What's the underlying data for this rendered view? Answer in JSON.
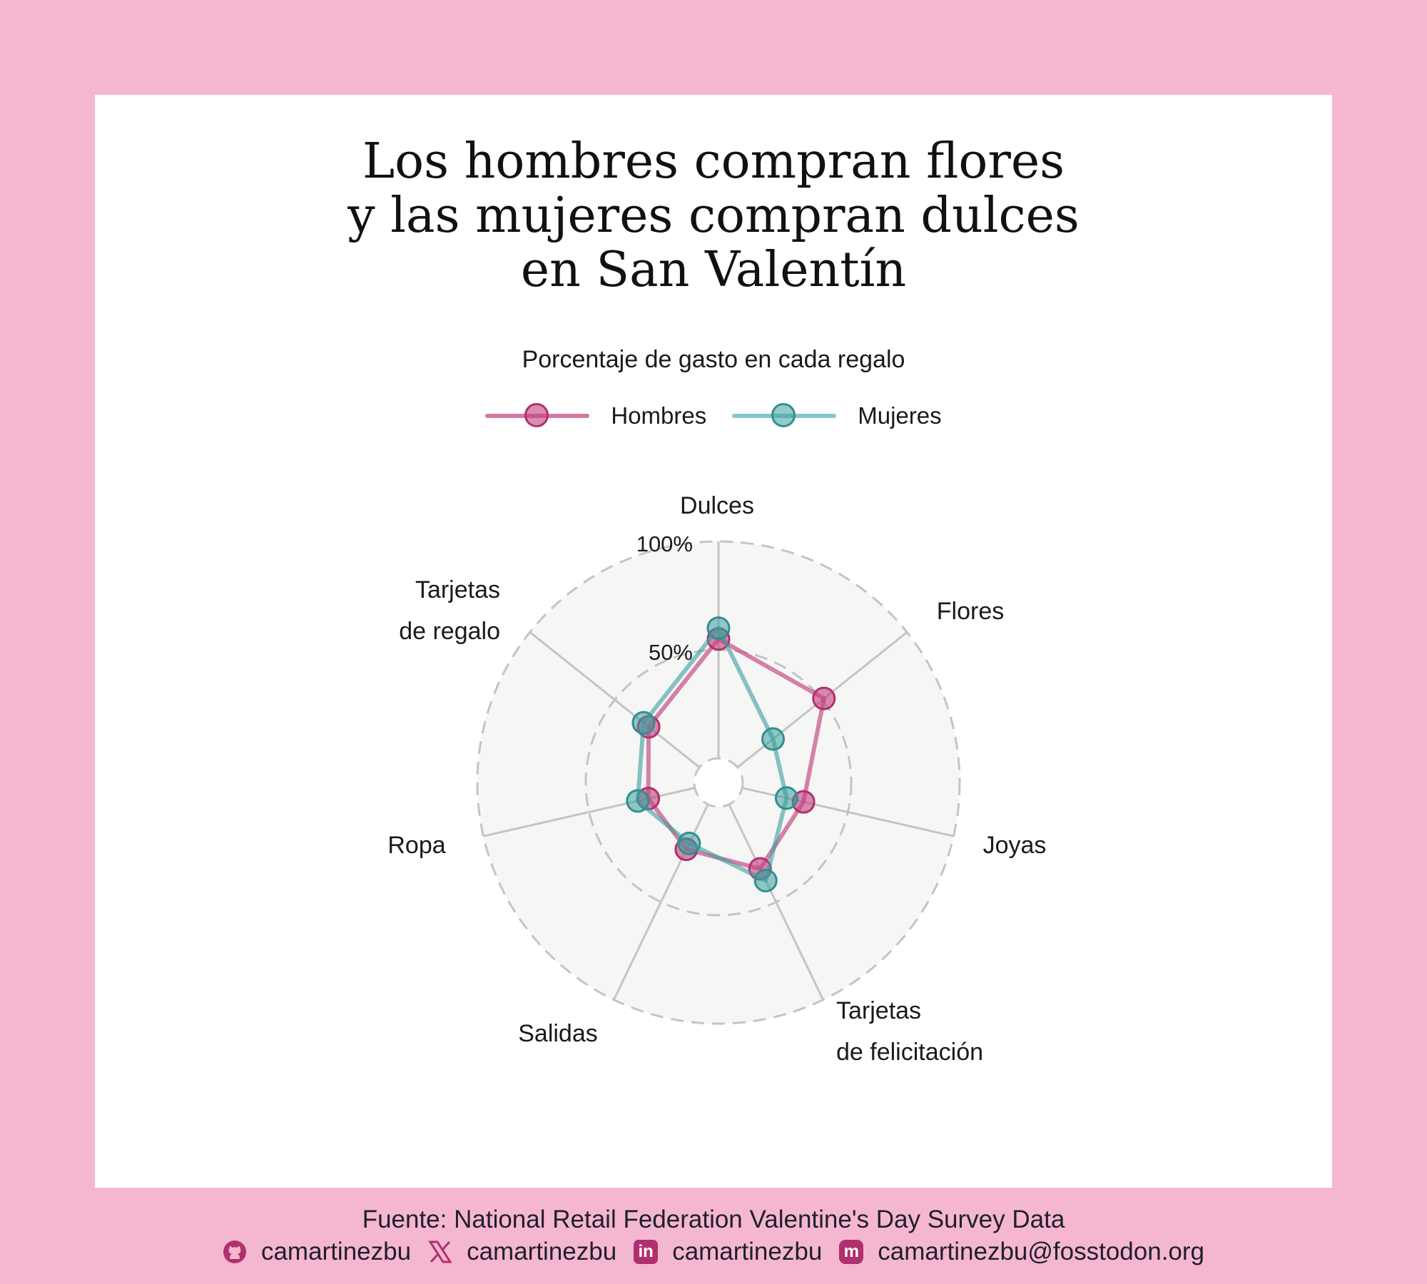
{
  "title_lines": [
    "Los hombres compran flores",
    "y las mujeres compran dulces",
    "en San Valentín"
  ],
  "subtitle": "Porcentaje de gasto en cada regalo",
  "colors": {
    "background": "#f5b7cf",
    "hombres": "#c2407f",
    "mujeres": "#3a9e9e",
    "grid": "#c4c4c4",
    "panel_fill": "#f6f6f4"
  },
  "chart_data": {
    "type": "radar",
    "categories": [
      "Dulces",
      "Flores",
      "Joyas",
      "Tarjetas de felicitación",
      "Salidas",
      "Ropa",
      "Tarjetas de regalo"
    ],
    "category_labels": [
      [
        "Dulces"
      ],
      [
        "Flores"
      ],
      [
        "Joyas"
      ],
      [
        "Tarjetas",
        "de felicitación"
      ],
      [
        "Salidas"
      ],
      [
        "Ropa"
      ],
      [
        "Tarjetas",
        "de regalo"
      ]
    ],
    "radial_ticks": [
      {
        "value": 50,
        "label": "50%"
      },
      {
        "value": 100,
        "label": "100%"
      }
    ],
    "rlim": [
      0,
      100
    ],
    "series": [
      {
        "name": "Hombres",
        "values": [
          55,
          51,
          29,
          33,
          23,
          22,
          30
        ]
      },
      {
        "name": "Mujeres",
        "values": [
          60,
          21,
          21,
          39,
          20,
          27,
          33
        ]
      }
    ]
  },
  "footer": {
    "source": "Fuente: National Retail Federation Valentine's Day Survey Data",
    "socials": [
      {
        "icon": "github-icon",
        "handle": "camartinezbu"
      },
      {
        "icon": "x-icon",
        "handle": "camartinezbu"
      },
      {
        "icon": "linkedin-icon",
        "handle": "camartinezbu"
      },
      {
        "icon": "mastodon-icon",
        "handle": "camartinezbu@fosstodon.org"
      }
    ]
  }
}
